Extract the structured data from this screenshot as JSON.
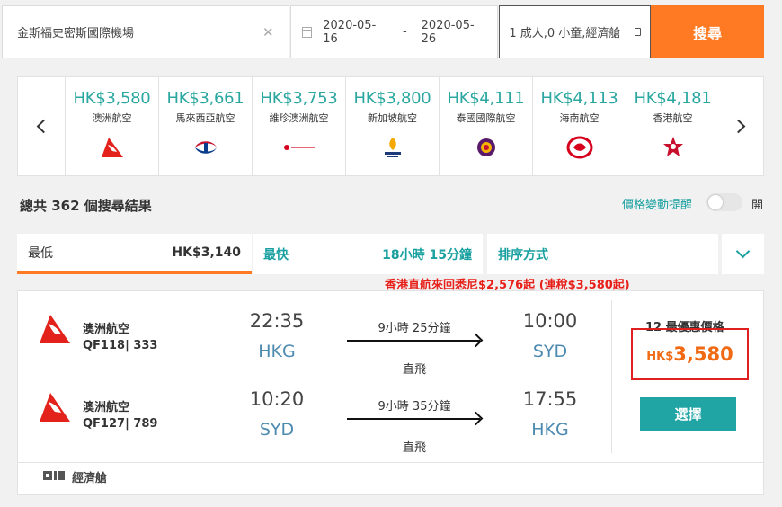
{
  "search": {
    "location": "金斯福史密斯國際機場",
    "date_from": "2020-05-16",
    "date_sep": "-",
    "date_to": "2020-05-26",
    "passengers": "1 成人,0 小童,經濟艙",
    "search_label": "搜尋"
  },
  "airlines": [
    {
      "price": "HK$3,580",
      "name": "澳洲航空",
      "icon": "qantas-logo"
    },
    {
      "price": "HK$3,661",
      "name": "馬來西亞航空",
      "icon": "malaysia-airlines-logo"
    },
    {
      "price": "HK$3,753",
      "name": "維珍澳洲航空",
      "icon": "virgin-australia-logo"
    },
    {
      "price": "HK$3,800",
      "name": "新加坡航空",
      "icon": "singapore-airlines-logo"
    },
    {
      "price": "HK$4,111",
      "name": "泰國國際航空",
      "icon": "thai-airways-logo"
    },
    {
      "price": "HK$4,113",
      "name": "海南航空",
      "icon": "hainan-airlines-logo"
    },
    {
      "price": "HK$4,181",
      "name": "香港航空",
      "icon": "hong-kong-airlines-logo"
    }
  ],
  "results": {
    "count_text": "總共 362 個搜尋結果",
    "alert_label": "價格變動提醒",
    "toggle_label": "開"
  },
  "tabs": {
    "cheapest_label": "最低",
    "cheapest_value": "HK$3,140",
    "fastest_label": "最快",
    "fastest_value": "18小時 15分鐘",
    "sort_label": "排序方式"
  },
  "promo": "香港直航來回悉尼$2,576起 (連稅$3,580起)",
  "card": {
    "outbound": {
      "airline": "澳洲航空",
      "flight": "QF118| 333",
      "dep_time": "22:35",
      "dep_code": "HKG",
      "duration": "9小時 25分鐘",
      "stops": "直飛",
      "arr_time": "10:00",
      "arr_code": "SYD"
    },
    "inbound": {
      "airline": "澳洲航空",
      "flight": "QF127| 789",
      "dep_time": "10:20",
      "dep_code": "SYD",
      "duration": "9小時 35分鐘",
      "stops": "直飛",
      "arr_time": "17:55",
      "arr_code": "HKG"
    },
    "deals": "12 最優惠價格",
    "currency": "HK$",
    "price": "3,580",
    "select_label": "選擇",
    "cabin": "經濟艙"
  },
  "colors": {
    "accent_orange": "#ff7a22",
    "teal": "#1aa0a0",
    "promo_red": "#e8201a",
    "highlight_border": "#e02020"
  }
}
